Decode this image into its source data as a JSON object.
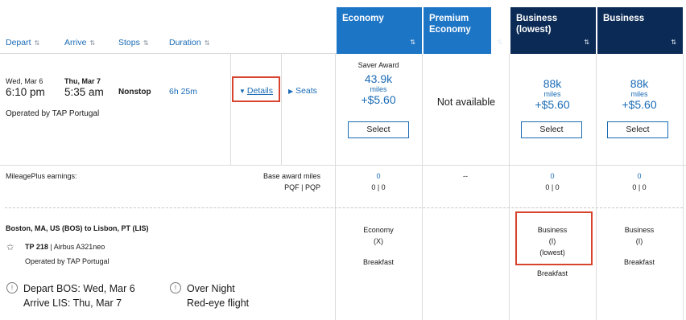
{
  "sort_headers": {
    "depart": "Depart",
    "arrive": "Arrive",
    "stops": "Stops",
    "duration": "Duration",
    "sort_glyph": "⇅"
  },
  "columns": [
    {
      "label": "Economy",
      "style": "economy"
    },
    {
      "label": "Premium Economy",
      "style": "economy"
    },
    {
      "label": "Business (lowest)",
      "style": "business"
    },
    {
      "label": "Business",
      "style": "business"
    }
  ],
  "flight": {
    "depart_date": "Wed, Mar 6",
    "depart_time": "6:10 pm",
    "arrive_date": "Thu, Mar 7",
    "arrive_time": "5:35 am",
    "stops": "Nonstop",
    "duration": "6h 25m",
    "operated_by": "Operated by TAP Portugal",
    "details_label": "Details",
    "seats_label": "Seats"
  },
  "fares": {
    "economy": {
      "tag": "Saver Award",
      "miles": "43.9k",
      "miles_label": "miles",
      "fee": "+$5.60",
      "button": "Select"
    },
    "premium_economy": {
      "text": "Not available"
    },
    "business_lowest": {
      "miles": "88k",
      "miles_label": "miles",
      "fee": "+$5.60",
      "button": "Select"
    },
    "business": {
      "miles": "88k",
      "miles_label": "miles",
      "fee": "+$5.60",
      "button": "Select"
    }
  },
  "earnings": {
    "label": "MileagePlus earnings:",
    "base_label": "Base award miles",
    "pqf_label": "PQF | PQP",
    "economy": {
      "miles": "0",
      "pq": "0 | 0"
    },
    "premium_economy": {
      "miles": "--"
    },
    "business_lowest": {
      "miles": "0",
      "pq": "0 | 0"
    },
    "business": {
      "miles": "0",
      "pq": "0 | 0"
    }
  },
  "segment": {
    "route": "Boston, MA, US (BOS) to Lisbon, PT (LIS)",
    "flight_number": "TP 218",
    "aircraft": "| Airbus A321neo",
    "operated_by": "Operated by TAP Portugal",
    "economy_cabin": [
      "Economy",
      "(X)",
      "Breakfast"
    ],
    "business_lowest_cabin": [
      "Business",
      "(I)",
      "(lowest)",
      "Breakfast"
    ],
    "business_cabin": [
      "Business",
      "(I)",
      "Breakfast"
    ],
    "depart_note": [
      "Depart BOS: Wed, Mar 6",
      "Arrive LIS: Thu, Mar 7"
    ],
    "overnight_note": [
      "Over Night",
      "Red-eye flight"
    ]
  },
  "colors": {
    "economy_header": "#1d75c6",
    "business_header": "#0b2a55",
    "link": "#1a6bb5",
    "highlight_box": "#d8432e"
  }
}
